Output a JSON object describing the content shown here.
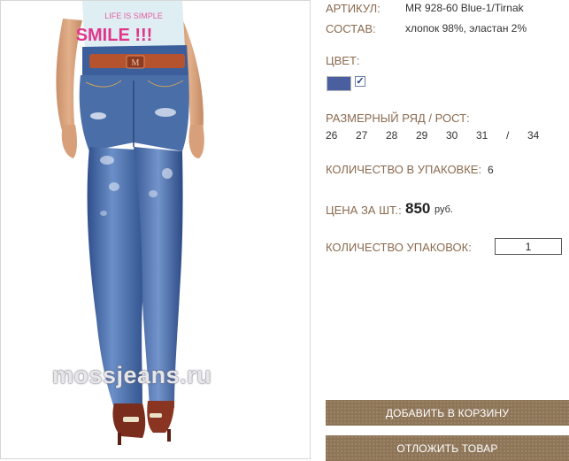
{
  "product": {
    "article_label": "АРТИКУЛ:",
    "article_value": "MR 928-60 Blue-1/Tirnak",
    "composition_label": "СОСТАВ:",
    "composition_value": "хлопок 98%, эластан 2%",
    "color_label": "ЦВЕТ:",
    "color_swatch": "#4a5fa0",
    "color_selected_mark": "✓",
    "size_label": "РАЗМЕРНЫЙ РЯД / РОСТ:",
    "sizes": [
      "26",
      "27",
      "28",
      "29",
      "30",
      "31",
      "/",
      "34"
    ],
    "pack_qty_label": "КОЛИЧЕСТВО В УПАКОВКЕ:",
    "pack_qty_value": "6",
    "price_label": "ЦЕНА ЗА ШТ.:",
    "price_value": "850",
    "price_currency": "руб.",
    "packs_label": "КОЛИЧЕСТВО УПАКОВОК:",
    "packs_value": "1"
  },
  "photo": {
    "watermark": "mossjeans.ru",
    "shirt_print": "SMILE !!!",
    "shirt_print_top": "LIFE IS SIMPLE",
    "buckle_mark": "M"
  },
  "actions": {
    "add_to_cart": "ДОБАВИТЬ В КОРЗИНУ",
    "postpone": "ОТЛОЖИТЬ ТОВАР"
  },
  "colors": {
    "label_brown": "#8a6a4f",
    "button_brown": "#8e7558"
  }
}
